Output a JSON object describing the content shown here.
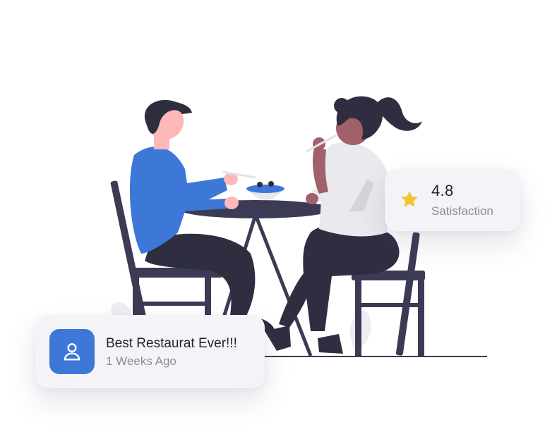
{
  "rating_card": {
    "icon": "star-icon",
    "value": "4.8",
    "label": "Satisfaction",
    "star_color": "#f4c430"
  },
  "review_card": {
    "icon": "user-icon",
    "title": "Best Restaurat Ever!!!",
    "time": "1 Weeks Ago",
    "accent_color": "#3d78d8"
  },
  "illustration": {
    "name": "two-people-dining"
  }
}
